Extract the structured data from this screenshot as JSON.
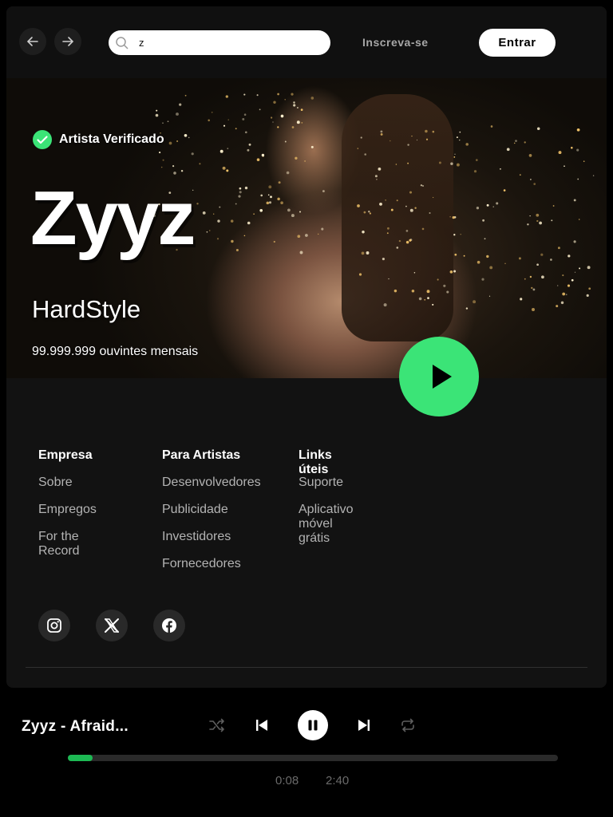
{
  "search": {
    "value": "z",
    "placeholder": ""
  },
  "header": {
    "signup_label": "Inscreva-se",
    "login_label": "Entrar"
  },
  "artist": {
    "verified_label": "Artista Verificado",
    "name": "Zyyz",
    "genre": "HardStyle",
    "listeners": "99.999.999 ouvintes mensais"
  },
  "footer": {
    "columns": [
      {
        "title": "Empresa",
        "links": [
          "Sobre",
          "Empregos",
          "For the Record"
        ]
      },
      {
        "title": "Para Artistas",
        "links": [
          "Desenvolvedores",
          "Publicidade",
          "Investidores",
          "Fornecedores"
        ]
      },
      {
        "title": "Links úteis",
        "links": [
          "Suporte",
          "Aplicativo móvel grátis"
        ]
      }
    ],
    "socials": [
      "instagram-icon",
      "x-icon",
      "facebook-icon"
    ]
  },
  "player": {
    "track_title": "Zyyz - Afraid...",
    "elapsed": "0:08",
    "duration": "2:40",
    "progress": 0.05
  },
  "colors": {
    "accent": "#1db954",
    "play_button": "#3be477",
    "background": "#121212"
  }
}
